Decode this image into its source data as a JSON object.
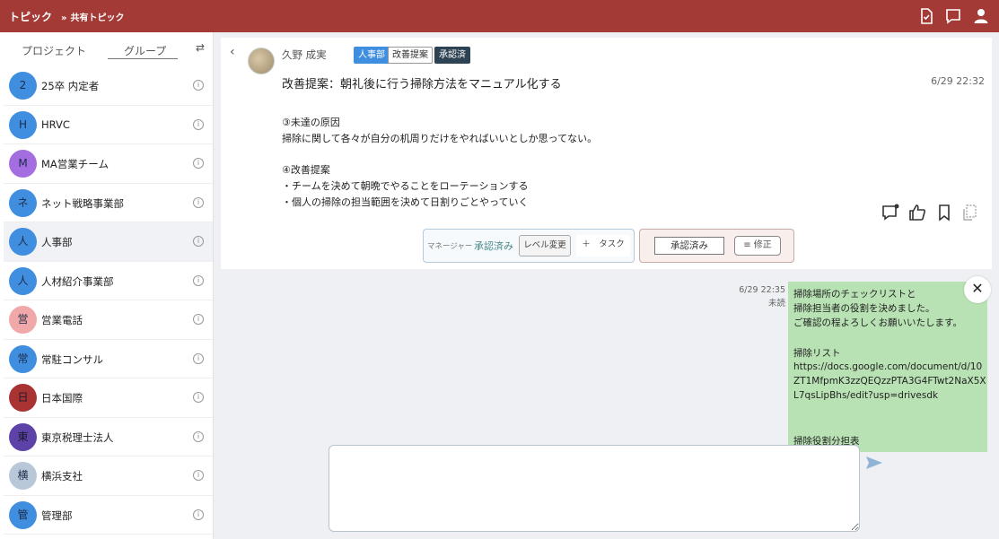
{
  "header": {
    "title": "トピック",
    "breadcrumb_sep": "»",
    "breadcrumb": "共有トピック",
    "icons": [
      "check-document-icon",
      "chat-icon",
      "user-icon"
    ]
  },
  "sidebar": {
    "tabs": [
      {
        "label": "プロジェクト"
      },
      {
        "label": "グループ"
      }
    ],
    "swap_icon": "⇄",
    "info_glyph": "i",
    "groups": [
      {
        "initial": "2",
        "name": "25卒 内定者",
        "color": "#3f8ee0"
      },
      {
        "initial": "H",
        "name": "HRVC",
        "color": "#3f8ee0"
      },
      {
        "initial": "M",
        "name": "MA営業チーム",
        "color": "#a46ee0"
      },
      {
        "initial": "ネ",
        "name": "ネット戦略事業部",
        "color": "#3f8ee0"
      },
      {
        "initial": "人",
        "name": "人事部",
        "color": "#3f8ee0"
      },
      {
        "initial": "人",
        "name": "人材紹介事業部",
        "color": "#3f8ee0"
      },
      {
        "initial": "営",
        "name": "営業電話",
        "color": "#f0a8a8"
      },
      {
        "initial": "常",
        "name": "常駐コンサル",
        "color": "#3f8ee0"
      },
      {
        "initial": "日",
        "name": "日本国際",
        "color": "#a93332"
      },
      {
        "initial": "東",
        "name": "東京税理士法人",
        "color": "#5d42a8"
      },
      {
        "initial": "横",
        "name": "横浜支社",
        "color": "#b9c8d8"
      },
      {
        "initial": "管",
        "name": "管理部",
        "color": "#3f8ee0"
      }
    ]
  },
  "post": {
    "back": "‹",
    "author": "久野 成実",
    "badges": [
      "人事部",
      "改善提案",
      "承認済"
    ],
    "title": "改善提案：朝礼後に行う掃除方法をマニュアル化する",
    "time": "6/29 22:32",
    "body": [
      "③未達の原因",
      "掃除に関して各々が自分の机周りだけをやればいいとしか思ってない。",
      "④改善提案",
      "・チームを決めて朝晩でやることをローテーションする",
      "・個人の掃除の担当範囲を決めて日割りごとやっていく"
    ],
    "action_icons": [
      "comment-icon",
      "thumbs-up-icon",
      "bookmark-icon",
      "copy-icon"
    ]
  },
  "approval": {
    "manager_label": "マネージャー",
    "status": "承認済み",
    "level_button": "レベル変更",
    "task_button": "＋　タスク",
    "approved_button": "承認済み",
    "edit_button": "≡ 修正"
  },
  "message": {
    "time": "6/29 22:35",
    "read_status": "未読",
    "close": "✕",
    "lines": [
      "掃除場所のチェックリストと",
      "掃除担当者の役割を決めました。",
      "ご確認の程よろしくお願いいたします。",
      "",
      "掃除リスト",
      "https://docs.google.com/document/d/10",
      "ZT1MfpmK3zzQEQzzPTA3G4FTwt2NaX5X",
      "L7qsLipBhs/edit?usp=drivesdk",
      "",
      "",
      "掃除役割分担表"
    ]
  },
  "composer": {
    "value": "",
    "placeholder": "",
    "send_icon": "send-icon"
  },
  "colors": {
    "header": "#a33a36",
    "bubble": "#b8e2b3",
    "accent": "#3f8ee0",
    "approved_badge": "#2d4253"
  }
}
